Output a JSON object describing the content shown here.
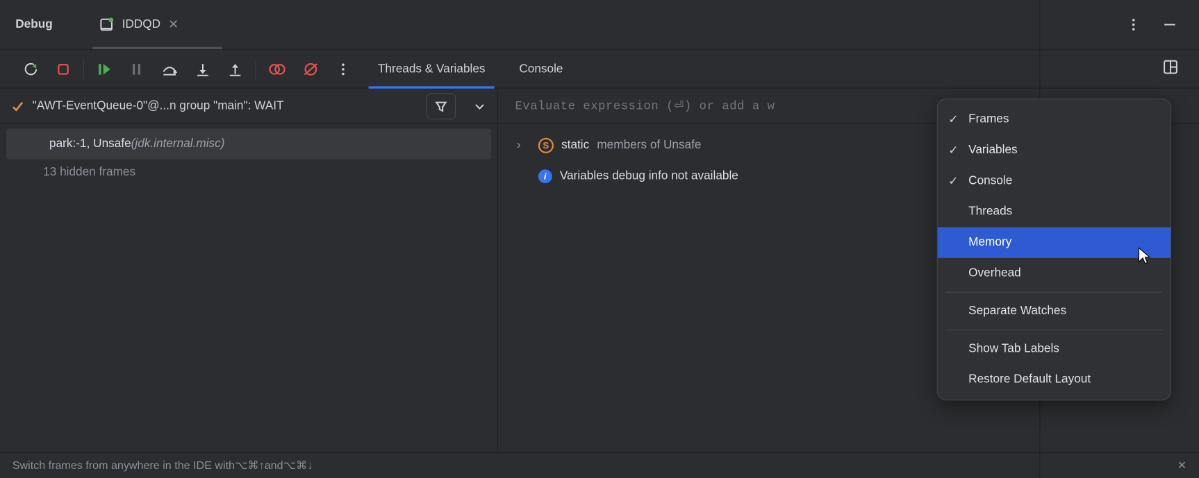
{
  "header": {
    "title": "Debug",
    "run_tab": "IDDQD"
  },
  "toolbar": {
    "tabs": {
      "threads": "Threads & Variables",
      "console": "Console"
    }
  },
  "thread": {
    "label": "\"AWT-EventQueue-0\"@...n group \"main\": WAIT"
  },
  "frames": {
    "top": {
      "name": "park:-1, Unsafe ",
      "pkg": "(jdk.internal.misc)"
    },
    "hidden": "13 hidden frames"
  },
  "eval": {
    "placeholder": "Evaluate expression (⏎) or add a w"
  },
  "vars": {
    "static_k": "static",
    "static_v": "members of Unsafe",
    "info": "Variables debug info not available"
  },
  "footer": {
    "tip_pre": "Switch frames from anywhere in the IDE with ",
    "k1": "⌥⌘↑",
    "mid": " and ",
    "k2": "⌥⌘↓"
  },
  "menu": {
    "frames": "Frames",
    "variables": "Variables",
    "console": "Console",
    "threads": "Threads",
    "memory": "Memory",
    "overhead": "Overhead",
    "sep_watches": "Separate Watches",
    "show_labels": "Show Tab Labels",
    "restore": "Restore Default Layout"
  }
}
